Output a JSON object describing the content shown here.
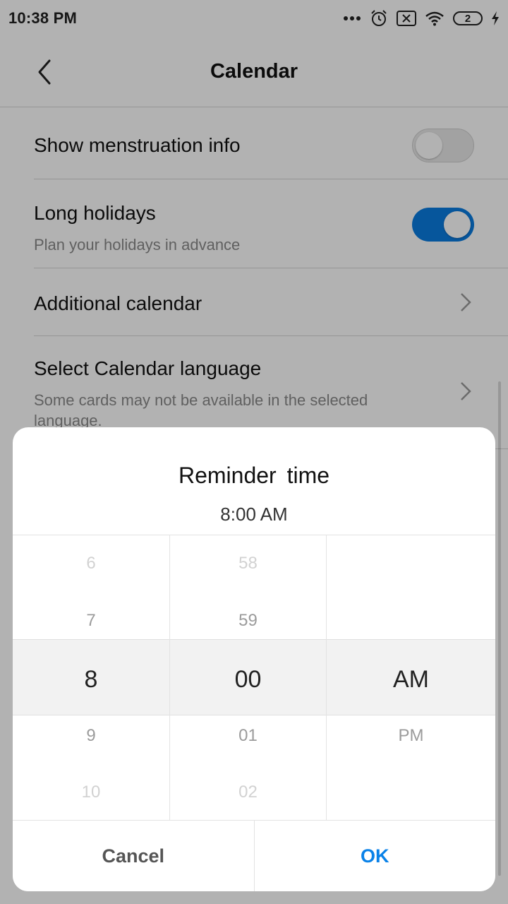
{
  "status_bar": {
    "time": "10:38 PM",
    "battery": "2"
  },
  "header": {
    "title": "Calendar"
  },
  "settings": [
    {
      "title": "Show menstruation info",
      "toggle": false
    },
    {
      "title": "Long holidays",
      "subtitle": "Plan your holidays in advance",
      "toggle": true
    },
    {
      "title": "Additional calendar"
    },
    {
      "title": "Select Calendar language",
      "subtitle": "Some cards may not be available in the selected language."
    }
  ],
  "dialog": {
    "title": "Reminder time",
    "current_value": "8:00 AM",
    "hours": {
      "far_above": "6",
      "above": "7",
      "selected": "8",
      "below": "9",
      "far_below": "10"
    },
    "minutes": {
      "far_above": "58",
      "above": "59",
      "selected": "00",
      "below": "01",
      "far_below": "02"
    },
    "meridiem": {
      "selected": "AM",
      "below": "PM"
    },
    "cancel_label": "Cancel",
    "ok_label": "OK"
  },
  "colors": {
    "accent": "#0a7be0",
    "ok_text": "#0a82e8"
  }
}
